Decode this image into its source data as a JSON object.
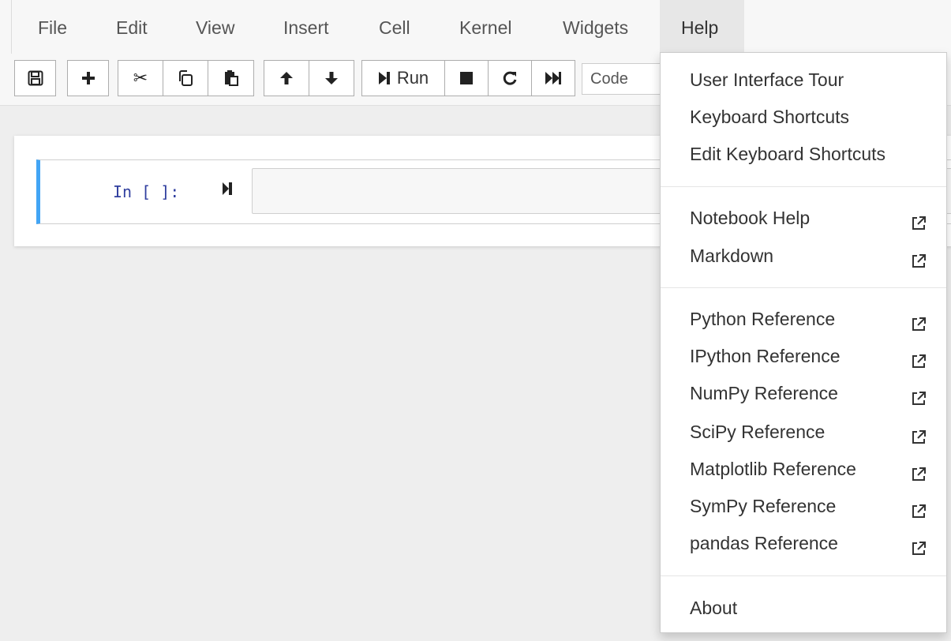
{
  "menubar": {
    "items": [
      "File",
      "Edit",
      "View",
      "Insert",
      "Cell",
      "Kernel",
      "Widgets",
      "Help"
    ],
    "active": "Help"
  },
  "toolbar": {
    "buttons": [
      {
        "name": "save-icon"
      },
      {
        "name": "plus-icon"
      },
      {
        "name": "cut-icon"
      },
      {
        "name": "copy-icon"
      },
      {
        "name": "paste-icon"
      },
      {
        "name": "arrow-up-icon"
      },
      {
        "name": "arrow-down-icon"
      },
      {
        "name": "step-forward-icon"
      },
      {
        "name": "stop-icon"
      },
      {
        "name": "restart-icon"
      },
      {
        "name": "fast-forward-icon"
      }
    ],
    "run_label": "Run",
    "cell_type": "Code"
  },
  "cell": {
    "prompt": "In [ ]:",
    "code": ""
  },
  "help_menu": {
    "group1": [
      "User Interface Tour",
      "Keyboard Shortcuts",
      "Edit Keyboard Shortcuts"
    ],
    "group2": [
      "Notebook Help",
      "Markdown"
    ],
    "group3": [
      "Python Reference",
      "IPython Reference",
      "NumPy Reference",
      "SciPy Reference",
      "Matplotlib Reference",
      "SymPy Reference",
      "pandas Reference"
    ],
    "group4": [
      "About"
    ]
  },
  "colors": {
    "cell_accent": "#42a5f5",
    "prompt": "#303f9f",
    "background": "#eeeeee"
  }
}
